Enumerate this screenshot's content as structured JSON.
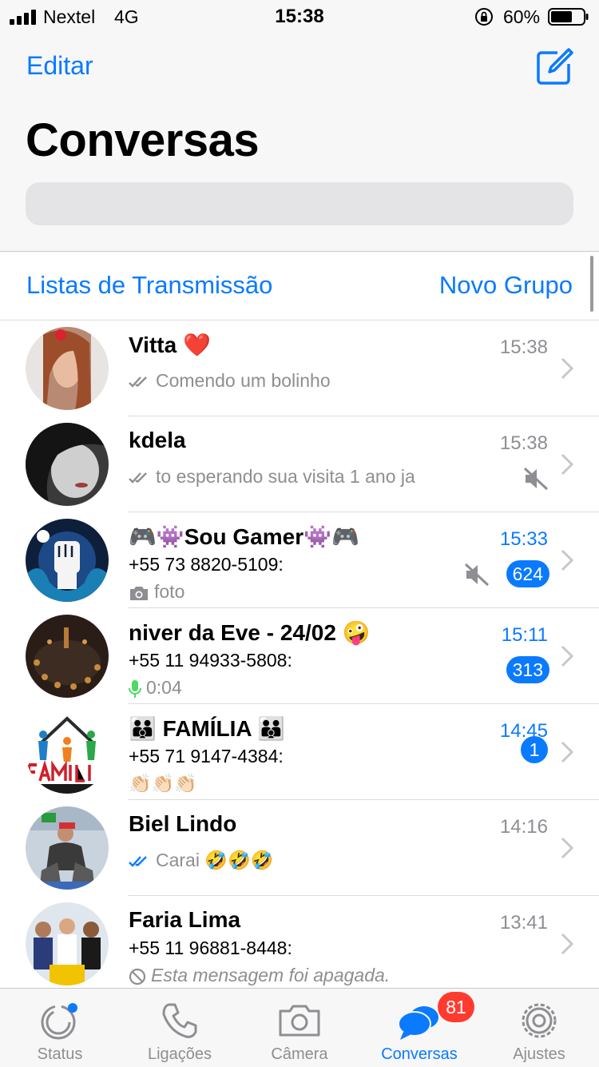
{
  "status_bar": {
    "carrier": "Nextel",
    "network": "4G",
    "time": "15:38",
    "battery_percent": "60%",
    "signal_icon": "signal-bars-icon",
    "lock_icon": "orientation-lock-icon",
    "battery_icon": "battery-icon"
  },
  "header": {
    "edit_label": "Editar",
    "compose_icon": "compose-icon",
    "title": "Conversas",
    "search_placeholder": ""
  },
  "actions": {
    "broadcast_label": "Listas de Transmissão",
    "new_group_label": "Novo Grupo"
  },
  "chats": [
    {
      "name": "Vitta ❤️",
      "time": "15:38",
      "time_unread": false,
      "read_ticks": "grey",
      "preview": "Comendo um bolinho",
      "muted": false,
      "badge": ""
    },
    {
      "name": "kdela",
      "time": "15:38",
      "time_unread": false,
      "read_ticks": "grey",
      "preview": "to esperando sua visita 1 ano ja",
      "muted": true,
      "badge": ""
    },
    {
      "name": "🎮👾Sou Gamer👾🎮",
      "time": "15:33",
      "time_unread": true,
      "sender": "+55 73 8820-5109:",
      "preview": "foto",
      "preview_icon": "camera-icon",
      "muted": true,
      "badge": "624"
    },
    {
      "name": "niver da Eve - 24/02 🤪",
      "time": "15:11",
      "time_unread": true,
      "sender": "+55 11 94933-5808:",
      "preview": "0:04",
      "preview_icon": "microphone-icon",
      "muted": false,
      "badge": "313"
    },
    {
      "name": "👪 FAMÍLIA 👪",
      "time": "14:45",
      "time_unread": true,
      "sender": "+55 71 9147-4384:",
      "preview": "👏🏻👏🏻👏🏻",
      "muted": false,
      "badge": "1"
    },
    {
      "name": "Biel Lindo",
      "time": "14:16",
      "time_unread": false,
      "read_ticks": "blue",
      "preview": "Carai 🤣🤣🤣",
      "muted": false,
      "badge": ""
    },
    {
      "name": "Faria Lima",
      "time": "13:41",
      "time_unread": false,
      "sender": "+55 11 96881-8448:",
      "preview": "Esta mensagem foi apagada.",
      "preview_icon": "deleted-icon",
      "muted": false,
      "badge": ""
    }
  ],
  "tabs": [
    {
      "label": "Status",
      "icon": "status-icon",
      "active": false
    },
    {
      "label": "Ligações",
      "icon": "phone-icon",
      "active": false
    },
    {
      "label": "Câmera",
      "icon": "camera-icon",
      "active": false
    },
    {
      "label": "Conversas",
      "icon": "chat-bubbles-icon",
      "active": true,
      "badge": "81"
    },
    {
      "label": "Ajustes",
      "icon": "gear-icon",
      "active": false
    }
  ],
  "colors": {
    "accent": "#0a7aff",
    "badge_red": "#ff3b30",
    "muted_grey": "#8e8e93",
    "voice_green": "#4cd964"
  }
}
